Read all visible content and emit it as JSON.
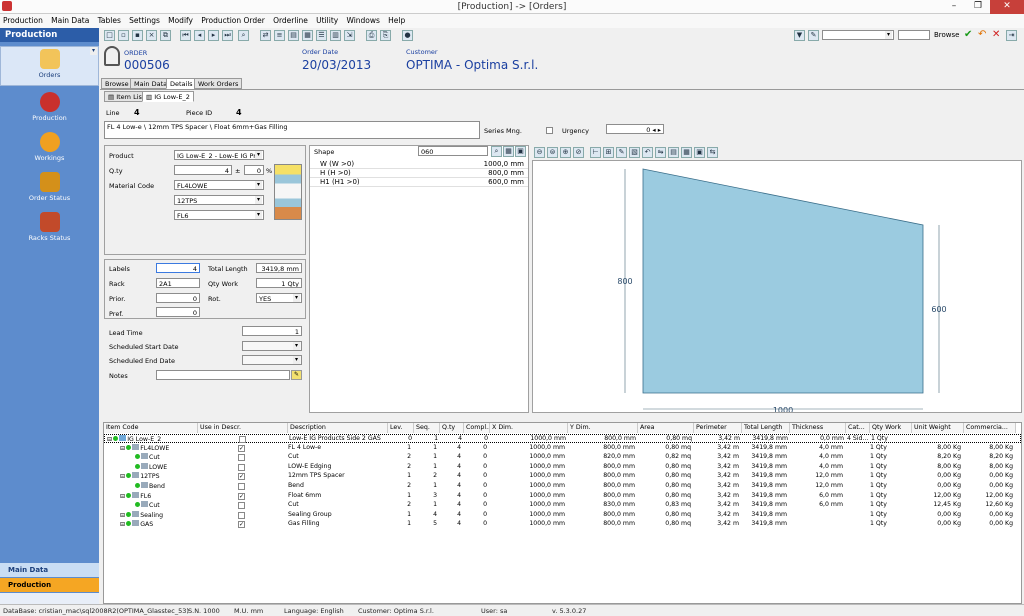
{
  "window": {
    "title": "[Production] -> [Orders]",
    "min": "–",
    "max": "❐",
    "close": "✕"
  },
  "menu": [
    "Production",
    "Main Data",
    "Tables",
    "Settings",
    "Modify",
    "Production Order",
    "Orderline",
    "Utility",
    "Windows",
    "Help"
  ],
  "toolbar": {
    "browse_label": "Browse"
  },
  "nav": {
    "title": "Production",
    "items": [
      {
        "label": "Orders",
        "color": "#f2c45a"
      },
      {
        "label": "Production",
        "color": "#c9302c"
      },
      {
        "label": "Workings",
        "color": "#f0a020"
      },
      {
        "label": "Order Status",
        "color": "#d4901a"
      },
      {
        "label": "Racks Status",
        "color": "#c24a2a"
      }
    ],
    "bottom": [
      "Main Data",
      "Production"
    ]
  },
  "order": {
    "order_label": "ORDER",
    "order_value": "000506",
    "date_label": "Order Date",
    "date_value": "20/03/2013",
    "customer_label": "Customer",
    "customer_value": "OPTIMA - Optima S.r.l."
  },
  "tabs": [
    "Browse",
    "Main Data",
    "Details",
    "Work Orders"
  ],
  "subtabs": [
    "Item List",
    "IG Low-E_2"
  ],
  "line": {
    "line_label": "Line",
    "line_value": "4",
    "piece_label": "Piece ID",
    "piece_value": "4"
  },
  "description": "FL 4 Low-e \\ 12mm TPS Spacer \\ Float 6mm+Gas Filling",
  "series_mng": "Series Mng.",
  "urgency": {
    "label": "Urgency",
    "value": "0"
  },
  "product": {
    "product_label": "Product",
    "product_value": "IG Low-E_2 - Low-E IG Pr",
    "qty_label": "Q.ty",
    "qty_value": "4",
    "qty_pm": "±",
    "qty_pct": "0",
    "qty_unit": "%",
    "material_label": "Material Code",
    "materials": [
      "FL4LOWE",
      "12TPS",
      "FL6"
    ]
  },
  "labels_panel": {
    "labels_label": "Labels",
    "labels_value": "4",
    "total_length_label": "Total Length",
    "total_length_value": "3419,8 mm",
    "rack_label": "Rack",
    "rack_value": "2A1",
    "qty_work_label": "Qty Work",
    "qty_work_value": "1 Qty",
    "prior_label": "Prior.",
    "prior_value": "0",
    "rot_label": "Rot.",
    "rot_value": "YES",
    "pref_label": "Pref.",
    "pref_value": "0"
  },
  "schedule": {
    "lead_time_label": "Lead Time",
    "lead_time_value": "1",
    "start_label": "Scheduled Start Date",
    "end_label": "Scheduled End Date",
    "notes_label": "Notes"
  },
  "shape": {
    "label": "Shape",
    "value": "060",
    "params": [
      {
        "name": "W (W >0)",
        "value": "1000,0 mm"
      },
      {
        "name": "H (H >0)",
        "value": "800,0 mm"
      },
      {
        "name": "H1 (H1 >0)",
        "value": "600,0 mm"
      }
    ]
  },
  "drawing": {
    "w": 1000,
    "h": 800,
    "h1": 600,
    "w_label": "1000",
    "h_label": "800",
    "h1_label": "600",
    "fill": "#9bcbe0"
  },
  "grid": {
    "headers": [
      "Item Code",
      "Use in Descr.",
      "Description",
      "Lev.",
      "Seq.",
      "Q.ty",
      "Compl...",
      "X Dim.",
      "Y Dim.",
      "Area",
      "Perimeter",
      "Total Length",
      "Thickness",
      "Cat...",
      "Qty Work",
      "Unit Weight",
      "Commercia..."
    ],
    "rows": [
      {
        "code": "IG Low-E_2",
        "indent": 0,
        "use": "",
        "desc": "Low-E IG Products Side 2 GAS",
        "lev": "0",
        "seq": "1",
        "qty": "4",
        "compl": "0",
        "x": "1000,0 mm",
        "y": "800,0 mm",
        "area": "0,80 mq",
        "per": "3,42 m",
        "tl": "3419,8 mm",
        "th": "0,0 mm",
        "cat": "4 Sid...",
        "qw": "1 Qty",
        "uw": "",
        "cw": ""
      },
      {
        "code": "FL4LOWE",
        "indent": 1,
        "use": "✓",
        "desc": "FL 4 Low-e",
        "lev": "1",
        "seq": "1",
        "qty": "4",
        "compl": "0",
        "x": "1000,0 mm",
        "y": "800,0 mm",
        "area": "0,80 mq",
        "per": "3,42 m",
        "tl": "3419,8 mm",
        "th": "4,0 mm",
        "cat": "",
        "qw": "1 Qty",
        "uw": "8,00 Kg",
        "cw": "8,00 Kg"
      },
      {
        "code": "Cut",
        "indent": 2,
        "use": "",
        "desc": "Cut",
        "lev": "2",
        "seq": "1",
        "qty": "4",
        "compl": "0",
        "x": "1000,0 mm",
        "y": "820,0 mm",
        "area": "0,82 mq",
        "per": "3,42 m",
        "tl": "3419,8 mm",
        "th": "4,0 mm",
        "cat": "",
        "qw": "1 Qty",
        "uw": "8,20 Kg",
        "cw": "8,20 Kg"
      },
      {
        "code": "LOWE",
        "indent": 2,
        "use": "",
        "desc": "LOW-E Edging",
        "lev": "2",
        "seq": "1",
        "qty": "4",
        "compl": "0",
        "x": "1000,0 mm",
        "y": "800,0 mm",
        "area": "0,80 mq",
        "per": "3,42 m",
        "tl": "3419,8 mm",
        "th": "4,0 mm",
        "cat": "",
        "qw": "1 Qty",
        "uw": "8,00 Kg",
        "cw": "8,00 Kg"
      },
      {
        "code": "12TPS",
        "indent": 1,
        "use": "✓",
        "desc": "12mm TPS Spacer",
        "lev": "1",
        "seq": "2",
        "qty": "4",
        "compl": "0",
        "x": "1000,0 mm",
        "y": "800,0 mm",
        "area": "0,80 mq",
        "per": "3,42 m",
        "tl": "3419,8 mm",
        "th": "12,0 mm",
        "cat": "",
        "qw": "1 Qty",
        "uw": "0,00 Kg",
        "cw": "0,00 Kg"
      },
      {
        "code": "Bend",
        "indent": 2,
        "use": "",
        "desc": "Bend",
        "lev": "2",
        "seq": "1",
        "qty": "4",
        "compl": "0",
        "x": "1000,0 mm",
        "y": "800,0 mm",
        "area": "0,80 mq",
        "per": "3,42 m",
        "tl": "3419,8 mm",
        "th": "12,0 mm",
        "cat": "",
        "qw": "1 Qty",
        "uw": "0,00 Kg",
        "cw": "0,00 Kg"
      },
      {
        "code": "FL6",
        "indent": 1,
        "use": "✓",
        "desc": "Float 6mm",
        "lev": "1",
        "seq": "3",
        "qty": "4",
        "compl": "0",
        "x": "1000,0 mm",
        "y": "800,0 mm",
        "area": "0,80 mq",
        "per": "3,42 m",
        "tl": "3419,8 mm",
        "th": "6,0 mm",
        "cat": "",
        "qw": "1 Qty",
        "uw": "12,00 Kg",
        "cw": "12,00 Kg"
      },
      {
        "code": "Cut",
        "indent": 2,
        "use": "",
        "desc": "Cut",
        "lev": "2",
        "seq": "1",
        "qty": "4",
        "compl": "0",
        "x": "1000,0 mm",
        "y": "830,0 mm",
        "area": "0,83 mq",
        "per": "3,42 m",
        "tl": "3419,8 mm",
        "th": "6,0 mm",
        "cat": "",
        "qw": "1 Qty",
        "uw": "12,45 Kg",
        "cw": "12,60 Kg"
      },
      {
        "code": "Sealing",
        "indent": 1,
        "use": "",
        "desc": "Sealing Group",
        "lev": "1",
        "seq": "4",
        "qty": "4",
        "compl": "0",
        "x": "1000,0 mm",
        "y": "800,0 mm",
        "area": "0,80 mq",
        "per": "3,42 m",
        "tl": "3419,8 mm",
        "th": "",
        "cat": "",
        "qw": "1 Qty",
        "uw": "0,00 Kg",
        "cw": "0,00 Kg"
      },
      {
        "code": "GAS",
        "indent": 1,
        "use": "✓",
        "desc": "Gas Filling",
        "lev": "1",
        "seq": "5",
        "qty": "4",
        "compl": "0",
        "x": "1000,0 mm",
        "y": "800,0 mm",
        "area": "0,80 mq",
        "per": "3,42 m",
        "tl": "3419,8 mm",
        "th": "",
        "cat": "",
        "qw": "1 Qty",
        "uw": "0,00 Kg",
        "cw": "0,00 Kg"
      }
    ]
  },
  "status": {
    "db": "DataBase: cristian_mac\\sql2008R2(OPTIMA_Glasstec_53)",
    "sn": "S.N. 1000",
    "mu": "M.U. mm",
    "lang": "Language: English",
    "cust": "Customer: Optima S.r.l.",
    "user": "User: sa",
    "ver": "v. 5.3.0.27"
  }
}
